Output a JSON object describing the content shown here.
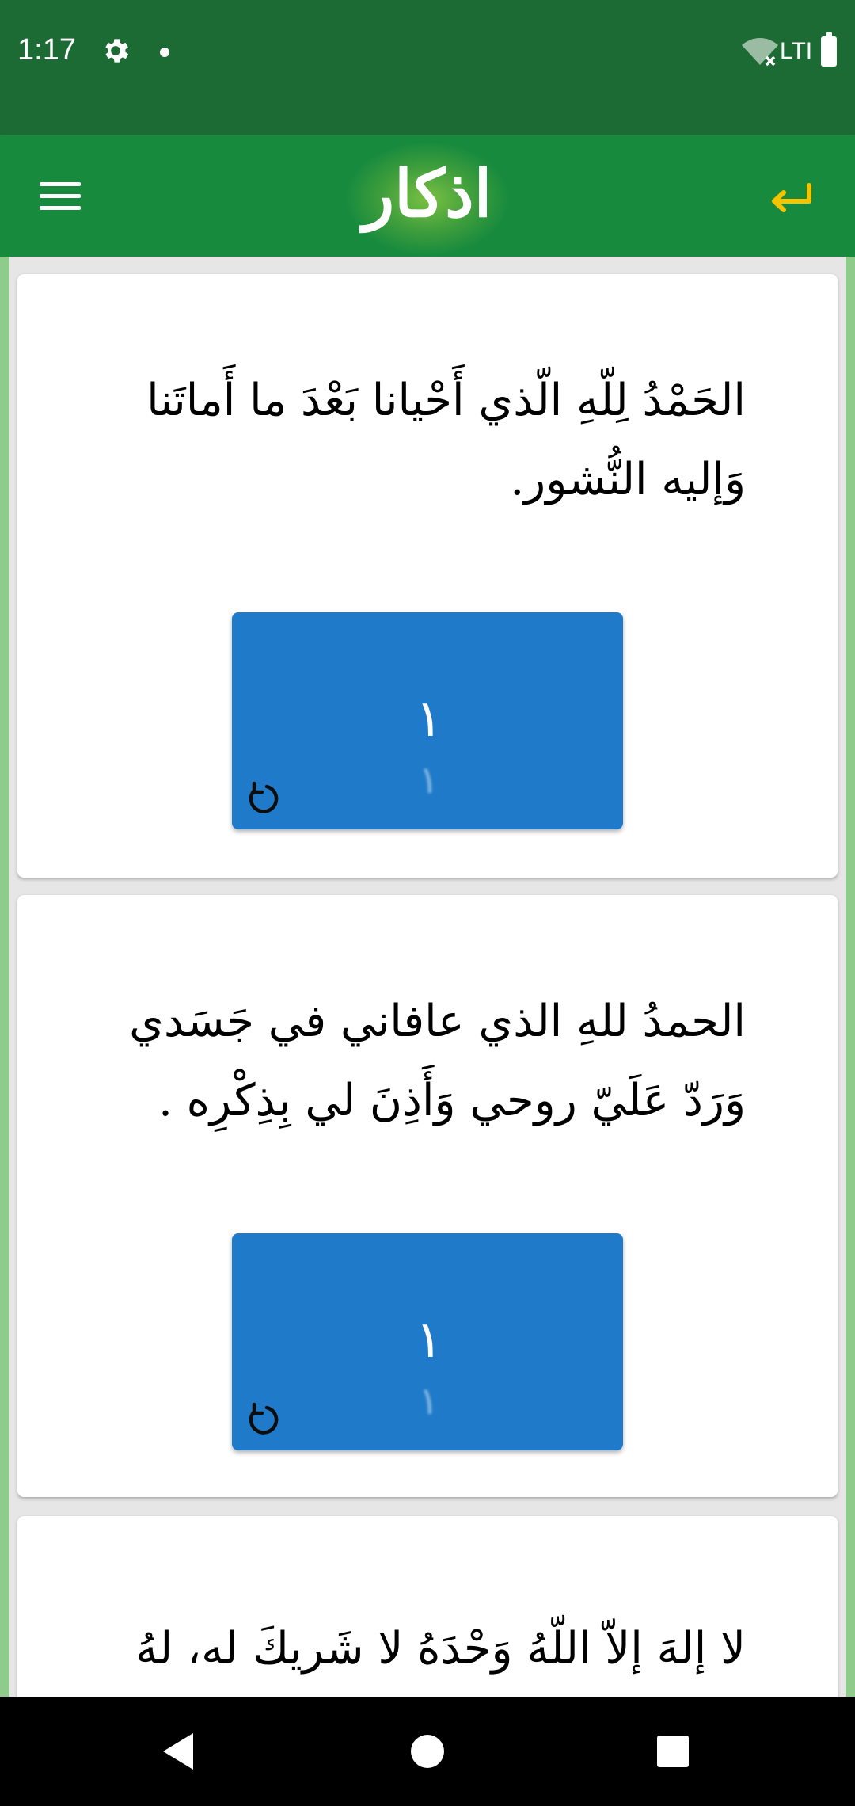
{
  "status_bar": {
    "time": "1:17",
    "network": "LTI",
    "icons": [
      "gear-icon",
      "dot-icon",
      "wifi-off-icon",
      "battery-icon"
    ]
  },
  "app_bar": {
    "title": "اذكار",
    "menu_icon": "menu-icon",
    "back_icon": "back-arrow-icon",
    "accent_color": "#f5c400",
    "bar_color": "#178a3e"
  },
  "cards": [
    {
      "text": "الحَمْدُ لِلّهِ الّذي أَحْيانا بَعْدَ ما أَماتَنا وَإليه النُّشور.",
      "count": "١",
      "reset_icon": "refresh-icon"
    },
    {
      "text": "الحمدُ للهِ الذي عافاني في جَسَدي وَرَدّ عَلَيّ روحي وَأَذِنَ لي بِذِكْرِه .",
      "count": "١",
      "reset_icon": "refresh-icon"
    },
    {
      "text": "لا إلهَ إلاّ اللّهُ وَحْدَهُ لا شَريكَ له، لهُ"
    }
  ],
  "counter_color": "#1f7bc9",
  "nav_bar": {
    "icons": [
      "back-triangle-icon",
      "home-circle-icon",
      "recents-square-icon"
    ]
  }
}
